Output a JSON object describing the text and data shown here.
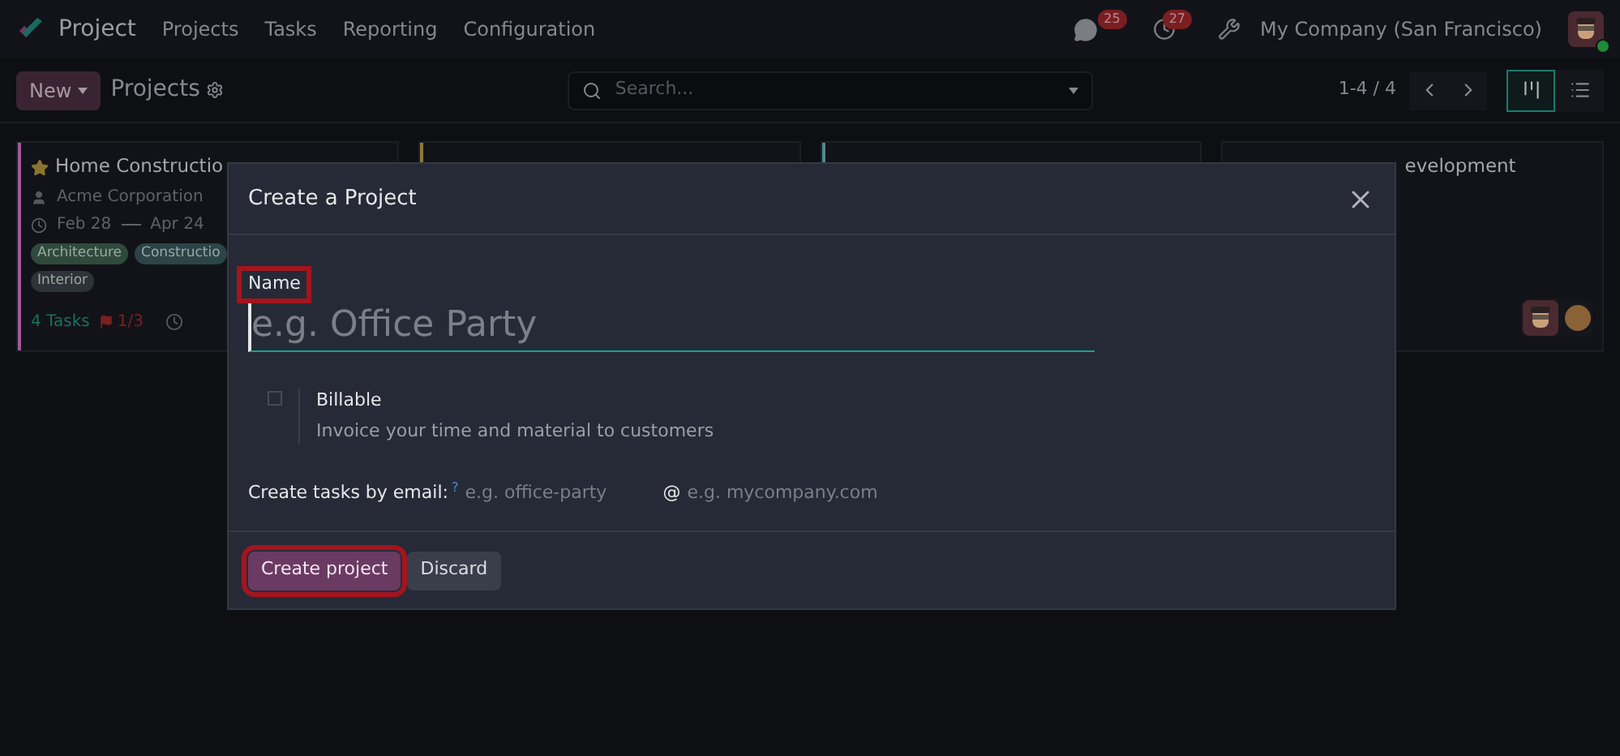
{
  "navbar": {
    "app_name": "Project",
    "menu": [
      "Projects",
      "Tasks",
      "Reporting",
      "Configuration"
    ],
    "messages_count": "25",
    "activities_count": "27",
    "company": "My Company (San Francisco)",
    "user_online": true
  },
  "control_panel": {
    "new_button": "New",
    "breadcrumb": "Projects",
    "search": {
      "placeholder": "Search..."
    },
    "pager": "1-4 / 4",
    "views": [
      {
        "kind": "kanban",
        "selected": true
      },
      {
        "kind": "list",
        "selected": false
      }
    ]
  },
  "cards": [
    {
      "title": "Home Constructio",
      "color": "#a05a9a",
      "favorite": true,
      "customer": "Acme Corporation",
      "date_start": "Feb 28",
      "date_end": "Apr 24",
      "tags": [
        {
          "label": "Architecture",
          "color": "#2f4a3c"
        },
        {
          "label": "Constructio",
          "color": "#2b4448"
        },
        {
          "label": "Interior",
          "color": "#2e3338"
        }
      ],
      "tasks": "4 Tasks",
      "milestones": "1/3"
    },
    {
      "color": "#8a7a3a"
    },
    {
      "color": "#4f8a8a"
    },
    {
      "title": "evelopment",
      "avatars": true
    }
  ],
  "dialog": {
    "title": "Create a Project",
    "name_label": "Name",
    "name_highlighted": true,
    "name_placeholder": "e.g. Office Party",
    "billable": {
      "label": "Billable",
      "help": "Invoice your time and material to customers",
      "checked": false
    },
    "email": {
      "label": "Create tasks by email:",
      "help_mark": "?",
      "alias_placeholder": "e.g. office-party",
      "at": "@",
      "domain_placeholder": "e.g. mycompany.com"
    },
    "buttons": [
      {
        "label": "Create project",
        "kind": "primary",
        "highlighted": true
      },
      {
        "label": "Discard",
        "kind": "secondary",
        "highlighted": false
      }
    ]
  }
}
